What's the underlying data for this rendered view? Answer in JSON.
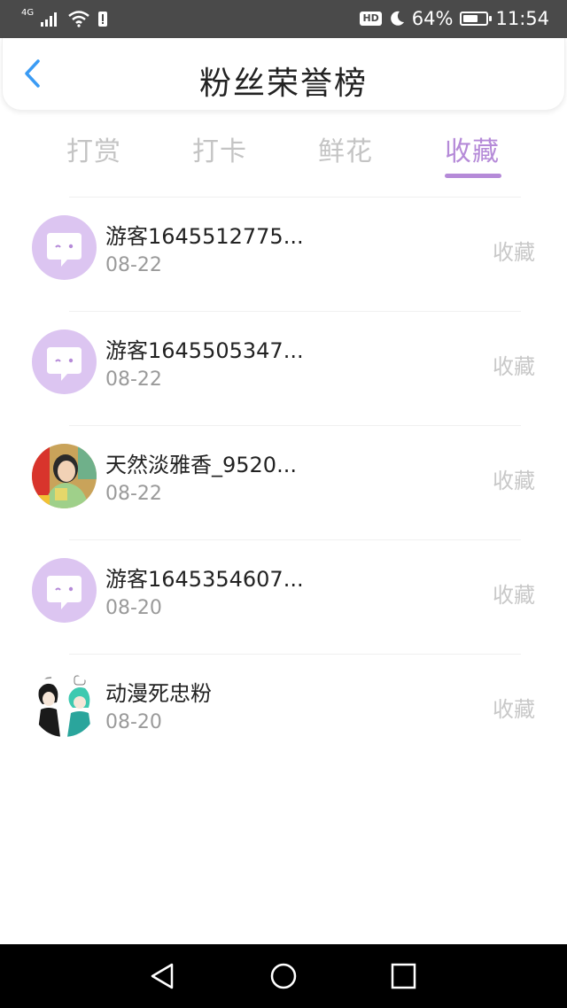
{
  "status_bar": {
    "network": "4G",
    "hd": "HD",
    "battery_percent": "64%",
    "battery_level": 0.64,
    "time": "11:54"
  },
  "header": {
    "title": "粉丝荣誉榜"
  },
  "tabs": [
    {
      "label": "打赏",
      "active": false
    },
    {
      "label": "打卡",
      "active": false
    },
    {
      "label": "鲜花",
      "active": false
    },
    {
      "label": "收藏",
      "active": true
    }
  ],
  "fans": [
    {
      "name": "游客1645512775...",
      "date": "08-22",
      "action": "收藏",
      "avatar": "default"
    },
    {
      "name": "游客1645505347...",
      "date": "08-22",
      "action": "收藏",
      "avatar": "default"
    },
    {
      "name": "天然淡雅香_9520...",
      "date": "08-22",
      "action": "收藏",
      "avatar": "photo"
    },
    {
      "name": "游客1645354607...",
      "date": "08-20",
      "action": "收藏",
      "avatar": "default"
    },
    {
      "name": "动漫死忠粉",
      "date": "08-20",
      "action": "收藏",
      "avatar": "drawing"
    }
  ],
  "colors": {
    "accent": "#b58ad8",
    "avatar_default_bg": "#dcc5f1",
    "back_arrow": "#3a9bf4"
  },
  "icons": {
    "back": "back-arrow-icon",
    "nav_back": "triangle-back-icon",
    "nav_home": "circle-home-icon",
    "nav_recents": "square-recents-icon"
  }
}
